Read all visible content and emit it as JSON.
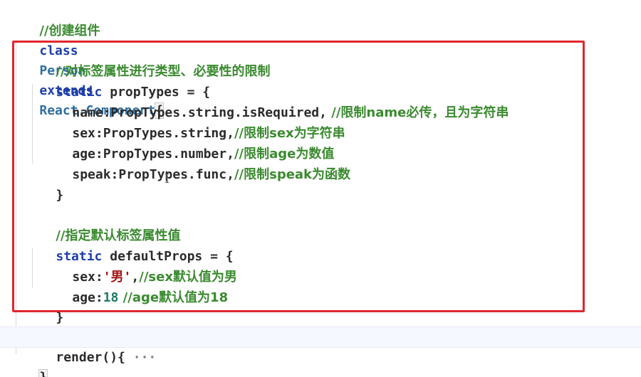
{
  "editor": {
    "lines": {
      "l1_comment": "//创建组件",
      "l2_class": "class",
      "l2_name": "Person",
      "l2_extends": "extends",
      "l2_react": "React",
      "l2_dot": ".",
      "l2_component": "Component",
      "l2_brace": "{",
      "l3_comment": "//对标签属性进行类型、必要性的限制",
      "l4_static": "static",
      "l4_rest": " propTypes = {",
      "l5_key": "name:",
      "l5_val": "PropTypes.string.isRequired,",
      "l5_comment": " //限制name必传，且为字符串",
      "l6_key": "sex:",
      "l6_val": "PropTypes.string,",
      "l6_comment": "//限制sex为字符串",
      "l7_key": "age:",
      "l7_val": "PropTypes.number,",
      "l7_comment": "//限制age为数值",
      "l8_key": "speak:",
      "l8_val": "PropTypes.func,",
      "l8_comment": "//限制speak为函数",
      "l9_close": "}",
      "l11_comment": "//指定默认标签属性值",
      "l12_static": "static",
      "l12_rest": " defaultProps = {",
      "l13_key": "sex:",
      "l13_val": "'男'",
      "l13_rest": ",",
      "l13_comment": "//sex默认值为男",
      "l14_key": "age:",
      "l14_val": "18",
      "l14_comment": " //age默认值为18",
      "l15_close": "}",
      "l17_render": "render(){",
      "l17_ellipsis": " ···",
      "l18_close": "}"
    },
    "cursor_glyph": "I",
    "highlight_color": "#e0262e"
  }
}
